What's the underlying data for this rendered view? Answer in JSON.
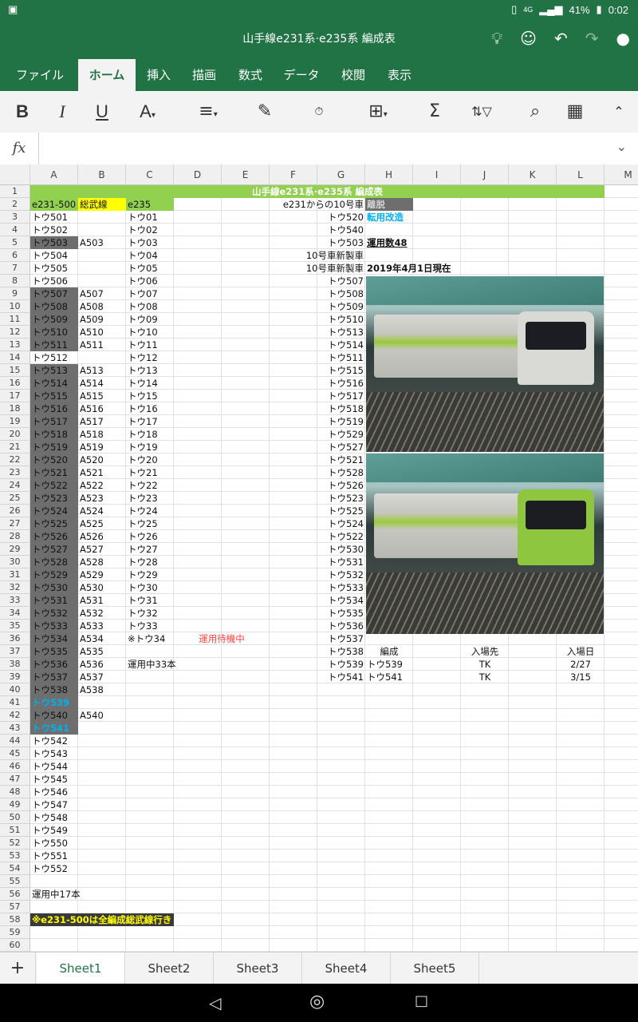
{
  "status": {
    "time": "0:02",
    "battery": "41%",
    "network": "4G"
  },
  "title": "山手線e231系·e235系 編成表",
  "ribbon_tabs": [
    "ファイル",
    "ホーム",
    "挿入",
    "描画",
    "数式",
    "データ",
    "校閲",
    "表示"
  ],
  "active_tab": "ホーム",
  "formula": {
    "fx": "fx",
    "value": ""
  },
  "columns": [
    "A",
    "B",
    "C",
    "D",
    "E",
    "F",
    "G",
    "H",
    "I",
    "J",
    "K",
    "L",
    "M"
  ],
  "rows": [
    "1",
    "2",
    "3",
    "4",
    "5",
    "6",
    "7",
    "8",
    "9",
    "10",
    "11",
    "12",
    "13",
    "14",
    "15",
    "16",
    "17",
    "18",
    "19",
    "20",
    "21",
    "22",
    "23",
    "24",
    "25",
    "26",
    "27",
    "28",
    "29",
    "30",
    "31",
    "32",
    "33",
    "34",
    "35",
    "36",
    "37",
    "38",
    "39",
    "40",
    "41",
    "42",
    "43",
    "44",
    "45",
    "46",
    "47",
    "48",
    "49",
    "50",
    "51",
    "52",
    "53",
    "54",
    "55",
    "56",
    "57",
    "58",
    "59",
    "60"
  ],
  "sheet_title": "山手線e231系·e235系 編成表",
  "headers": {
    "a2": "e231-500",
    "b2": "総武線",
    "c2": "e235",
    "f2": "e231からの10号車",
    "h2": "離脱"
  },
  "col_a": [
    "トウ501",
    "トウ502",
    "トウ503",
    "トウ504",
    "トウ505",
    "トウ506",
    "トウ507",
    "トウ508",
    "トウ509",
    "トウ510",
    "トウ511",
    "トウ512",
    "トウ513",
    "トウ514",
    "トウ515",
    "トウ516",
    "トウ517",
    "トウ518",
    "トウ519",
    "トウ520",
    "トウ521",
    "トウ522",
    "トウ523",
    "トウ524",
    "トウ525",
    "トウ526",
    "トウ527",
    "トウ528",
    "トウ529",
    "トウ530",
    "トウ531",
    "トウ532",
    "トウ533",
    "トウ534",
    "トウ535",
    "トウ536",
    "トウ537",
    "トウ538",
    "トウ539",
    "トウ540",
    "トウ541",
    "トウ542",
    "トウ543",
    "トウ544",
    "トウ545",
    "トウ546",
    "トウ547",
    "トウ548",
    "トウ549",
    "トウ550",
    "トウ551",
    "トウ552"
  ],
  "col_b": [
    "",
    "",
    "A503",
    "",
    "",
    "",
    "A507",
    "A508",
    "A509",
    "A510",
    "A511",
    "",
    "A513",
    "A514",
    "A515",
    "A516",
    "A517",
    "A518",
    "A519",
    "A520",
    "A521",
    "A522",
    "A523",
    "A524",
    "A525",
    "A526",
    "A527",
    "A528",
    "A529",
    "A530",
    "A531",
    "A532",
    "A533",
    "A534",
    "A535",
    "A536",
    "A537",
    "A538",
    "",
    "A540",
    ""
  ],
  "col_c": [
    "トウ01",
    "トウ02",
    "トウ03",
    "トウ04",
    "トウ05",
    "トウ06",
    "トウ07",
    "トウ08",
    "トウ09",
    "トウ10",
    "トウ11",
    "トウ12",
    "トウ13",
    "トウ14",
    "トウ15",
    "トウ16",
    "トウ17",
    "トウ18",
    "トウ19",
    "トウ20",
    "トウ21",
    "トウ22",
    "トウ23",
    "トウ24",
    "トウ25",
    "トウ26",
    "トウ27",
    "トウ28",
    "トウ29",
    "トウ30",
    "トウ31",
    "トウ32",
    "トウ33",
    "※トウ34"
  ],
  "d36": "運用待機中",
  "c38": "運用中33本",
  "col_g": [
    "トウ520",
    "トウ540",
    "トウ503",
    "10号車新製車",
    "10号車新製車",
    "トウ507",
    "トウ508",
    "トウ509",
    "トウ510",
    "トウ513",
    "トウ514",
    "トウ511",
    "トウ515",
    "トウ516",
    "トウ517",
    "トウ518",
    "トウ519",
    "トウ529",
    "トウ527",
    "トウ521",
    "トウ528",
    "トウ526",
    "トウ523",
    "トウ525",
    "トウ524",
    "トウ522",
    "トウ530",
    "トウ531",
    "トウ532",
    "トウ533",
    "トウ534",
    "トウ535",
    "トウ536",
    "トウ537",
    "トウ538",
    "トウ539",
    "トウ541"
  ],
  "h3": "転用改造",
  "h5": "運用数48",
  "h7": "2019年4月1日現在",
  "table37": {
    "h": "編成",
    "j": "入場先",
    "l": "入場日"
  },
  "table38": {
    "h": "トウ539",
    "j": "TK",
    "l": "2/27"
  },
  "table39": {
    "h": "トウ541",
    "j": "TK",
    "l": "3/15"
  },
  "a56": "運用中17本",
  "a58": "※e231-500は全編成総武線行き",
  "sheets": [
    "Sheet1",
    "Sheet2",
    "Sheet3",
    "Sheet4",
    "Sheet5"
  ],
  "active_sheet": "Sheet1",
  "colors": {
    "brand": "#217346",
    "green_fill": "#92d050",
    "gray_fill": "#6e6e6e",
    "yellow_fill": "#ffff00",
    "blue_text": "#00b0f0",
    "red_text": "#ff4444"
  }
}
